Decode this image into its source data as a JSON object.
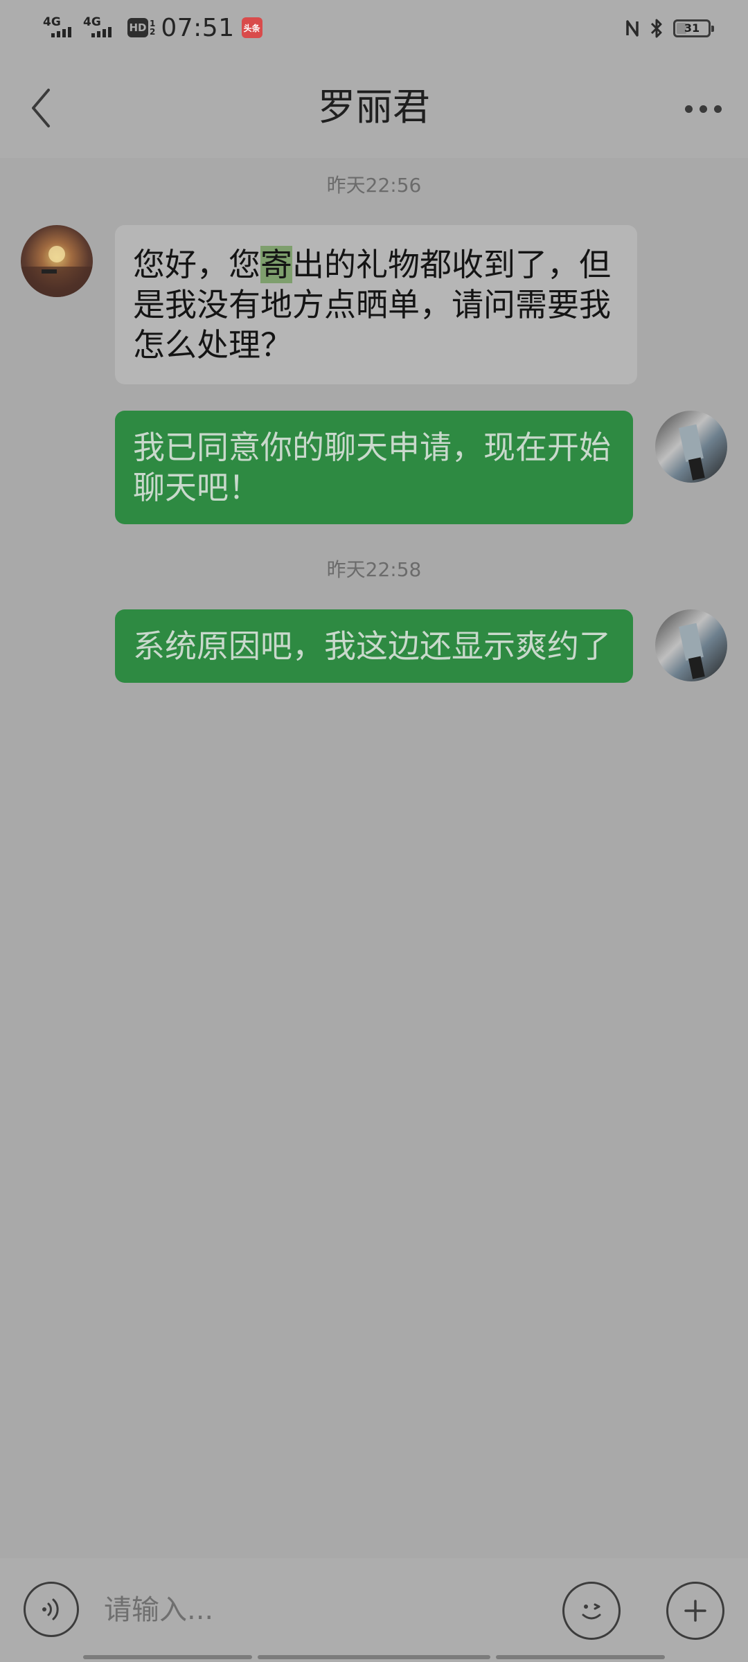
{
  "status_bar": {
    "network1": "4G",
    "network2": "4G",
    "hd_label": "HD",
    "hd_sub": "1\n2",
    "time": "07:51",
    "news_app_label": "头条",
    "battery_level": 31,
    "battery_text": "31"
  },
  "header": {
    "title": "罗丽君",
    "back_icon": "chevron-left-icon",
    "more_icon": "more-horizontal-icon"
  },
  "messages": {
    "time1": "昨天22:56",
    "msg1_before": "您好，您",
    "msg1_highlight": "寄",
    "msg1_after": "出的礼物都收到了，但是我没有地方点晒单，请问需要我怎么处理？",
    "msg2": "我已同意你的聊天申请，现在开始聊天吧！",
    "time2": "昨天22:58",
    "msg3": "系统原因吧，我这边还显示爽约了"
  },
  "input_bar": {
    "placeholder": "请输入...",
    "voice_icon": "voice-icon",
    "emoji_icon": "emoji-icon",
    "plus_icon": "plus-icon"
  },
  "colors": {
    "background": "#a9a9a9",
    "bar_background": "#adadad",
    "incoming_bubble": "#b6b6b6",
    "outgoing_bubble": "#2e8a42",
    "highlight": "#7e9f6d"
  }
}
